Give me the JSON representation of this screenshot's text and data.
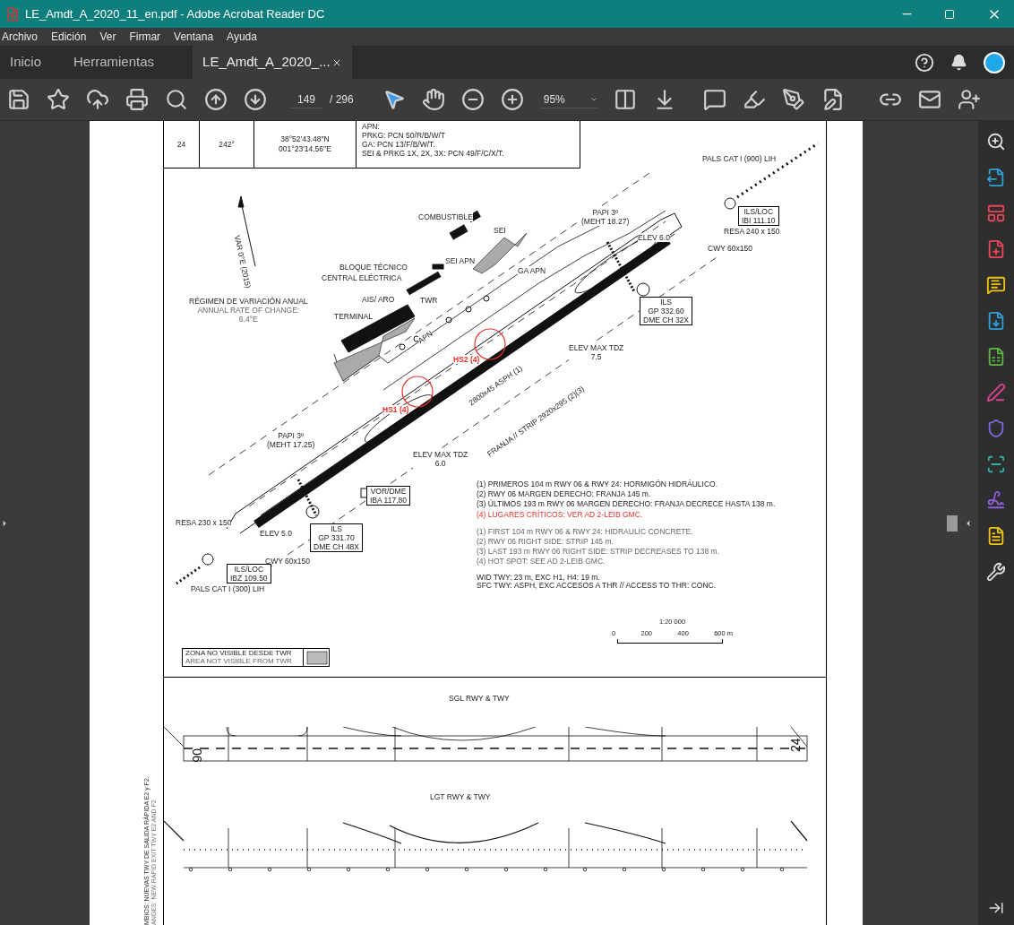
{
  "window": {
    "title": "LE_Amdt_A_2020_11_en.pdf - Adobe Acrobat Reader DC"
  },
  "menu": [
    "Archivo",
    "Edición",
    "Ver",
    "Firmar",
    "Ventana",
    "Ayuda"
  ],
  "tabs": [
    {
      "label": "Inicio",
      "selected": false
    },
    {
      "label": "Herramientas",
      "selected": false
    },
    {
      "label": "LE_Amdt_A_2020_...",
      "selected": true
    }
  ],
  "toolbar": {
    "page": "149",
    "page_count": "/ 296",
    "zoom": "95%"
  },
  "table_row": {
    "cells": [
      "24",
      "242°"
    ],
    "coordinates": [
      "38°52′43.48′′N",
      "001°23′14.56′′E"
    ],
    "remarks": [
      "APN:",
      "PRKG: PCN 50/R/B/W/T",
      "GA: PCN 13/F/B/W/T.",
      "SEI & PRKG 1X, 2X, 3X: PCN 49/F/C/X/T."
    ]
  },
  "map_labels": [
    {
      "kind": "plain",
      "lines": [
        "PALS CAT I (900) LIH"
      ]
    },
    {
      "kind": "boxed",
      "lines": [
        "ILS/LOC",
        "IBI 111.10"
      ]
    },
    {
      "kind": "plain",
      "lines": [
        "RESA 240 x 150"
      ]
    },
    {
      "kind": "plain",
      "lines": [
        "CWY 60x150"
      ]
    },
    {
      "kind": "plain",
      "lines": [
        "ELEV 6.0"
      ]
    },
    {
      "kind": "plain",
      "lines": [
        "COMBUSTIBLE"
      ]
    },
    {
      "kind": "plain",
      "lines": [
        "PAPI 3º",
        "(MEHT 18.27)"
      ]
    },
    {
      "kind": "plain",
      "lines": [
        "SEI"
      ]
    },
    {
      "kind": "plain",
      "lines": [
        "SEI APN"
      ]
    },
    {
      "kind": "plain",
      "lines": [
        "GA APN"
      ]
    },
    {
      "kind": "plain",
      "lines": [
        "BLOQUE TÉCNICO"
      ]
    },
    {
      "kind": "plain",
      "lines": [
        "CENTRAL ELÉCTRICA"
      ]
    },
    {
      "kind": "plain",
      "lines": [
        "RÉGIMEN DE VARIACIÓN ANUAL",
        "ANNUAL RATE OF CHANGE:",
        "6.4°E"
      ]
    },
    {
      "kind": "plain",
      "lines": [
        "AIS/ ARO"
      ]
    },
    {
      "kind": "plain",
      "lines": [
        "TWR"
      ]
    },
    {
      "kind": "plain",
      "lines": [
        "TERMINAL"
      ]
    },
    {
      "kind": "rotated",
      "lines": [
        "APN"
      ]
    },
    {
      "kind": "steep",
      "lines": [
        "VAR 0°E (2015)"
      ]
    },
    {
      "kind": "boxed",
      "lines": [
        "ILS",
        "GP 332.60",
        "DME CH 32X"
      ]
    },
    {
      "kind": "plain",
      "lines": [
        "ELEV MAX TDZ",
        "7.5"
      ]
    },
    {
      "kind": "hotspot",
      "lines": [
        "HS2 (4)"
      ]
    },
    {
      "kind": "hotspot",
      "lines": [
        "HS1 (4)"
      ]
    },
    {
      "kind": "rotated",
      "lines": [
        "2800x45 ASPH (1)"
      ]
    },
    {
      "kind": "rotated",
      "lines": [
        "FRANJA // STRIP 2920x295 (2)(3)"
      ]
    },
    {
      "kind": "plain",
      "lines": [
        "PAPI 3º",
        "(MEHT 17.25)"
      ]
    },
    {
      "kind": "plain",
      "lines": [
        "ELEV MAX TDZ",
        "6.0"
      ]
    },
    {
      "kind": "boxed",
      "lines": [
        "VOR/DME",
        "IBA 117.80"
      ]
    },
    {
      "kind": "plain",
      "lines": [
        "RESA 230 x 150"
      ]
    },
    {
      "kind": "plain",
      "lines": [
        "ELEV 5.0"
      ]
    },
    {
      "kind": "boxed",
      "lines": [
        "ILS",
        "GP 331.70",
        "DME CH 48X"
      ]
    },
    {
      "kind": "plain",
      "lines": [
        "CWY 60x150"
      ]
    },
    {
      "kind": "boxed",
      "lines": [
        "ILS/LOC",
        "IBZ 109.50"
      ]
    },
    {
      "kind": "plain",
      "lines": [
        "PALS CAT I (300) LIH"
      ]
    }
  ],
  "notes_es": [
    {
      "text": "(1) PRIMEROS 104 m RWY 06 & RWY 24: HORMIGÓN HIDRÁULICO.",
      "alert": false
    },
    {
      "text": "(2) RWY 06 MARGEN DERECHO: FRANJA 145 m.",
      "alert": false
    },
    {
      "text": "(3) ÚLTIMOS 193 m RWY 06 MARGEN DERECHO: FRANJA DECRECE HASTA 138 m.",
      "alert": false
    },
    {
      "text": "(4) LUGARES CRÍTICOS: VER AD 2-LEIB GMC.",
      "alert": true
    }
  ],
  "notes_en": [
    "(1) FIRST 104 m RWY 06 & RWY 24: HIDRAULIC CONCRETE.",
    "(2) RWY 06 RIGHT SIDE: STRIP 145 m.",
    "(3) LAST 193 m RWY 06 RIGHT SIDE: STRIP DECREASES TO 138 m.",
    "(4) HOT SPOT: SEE AD 2-LEIB GMC."
  ],
  "notes_twy": [
    "WID TWY: 23 m, EXC H1, H4: 19 m.",
    "SFC TWY: ASPH, EXC ACCESOS A THR // ACCESS TO THR: CONC."
  ],
  "scale": {
    "ratio": "1:20 000",
    "ticks": [
      "0",
      "200",
      "400",
      "600 m"
    ]
  },
  "legend": [
    "ZONA NO VISIBLE DESDE TWR",
    "AREA NOT VISIBLE FROM TWR"
  ],
  "panels": [
    {
      "title": "SGL RWY & TWY",
      "kind": "markings",
      "ends": [
        "06",
        "24"
      ]
    },
    {
      "title": "LGT RWY & TWY",
      "kind": "lights"
    }
  ],
  "side_note": [
    "MBIOS: NUEVAS TWY DE SALIDA RÁPIDA E2 y F2.",
    "ANGES: NEW RAPID EXIT TWY E2 AND F2."
  ]
}
